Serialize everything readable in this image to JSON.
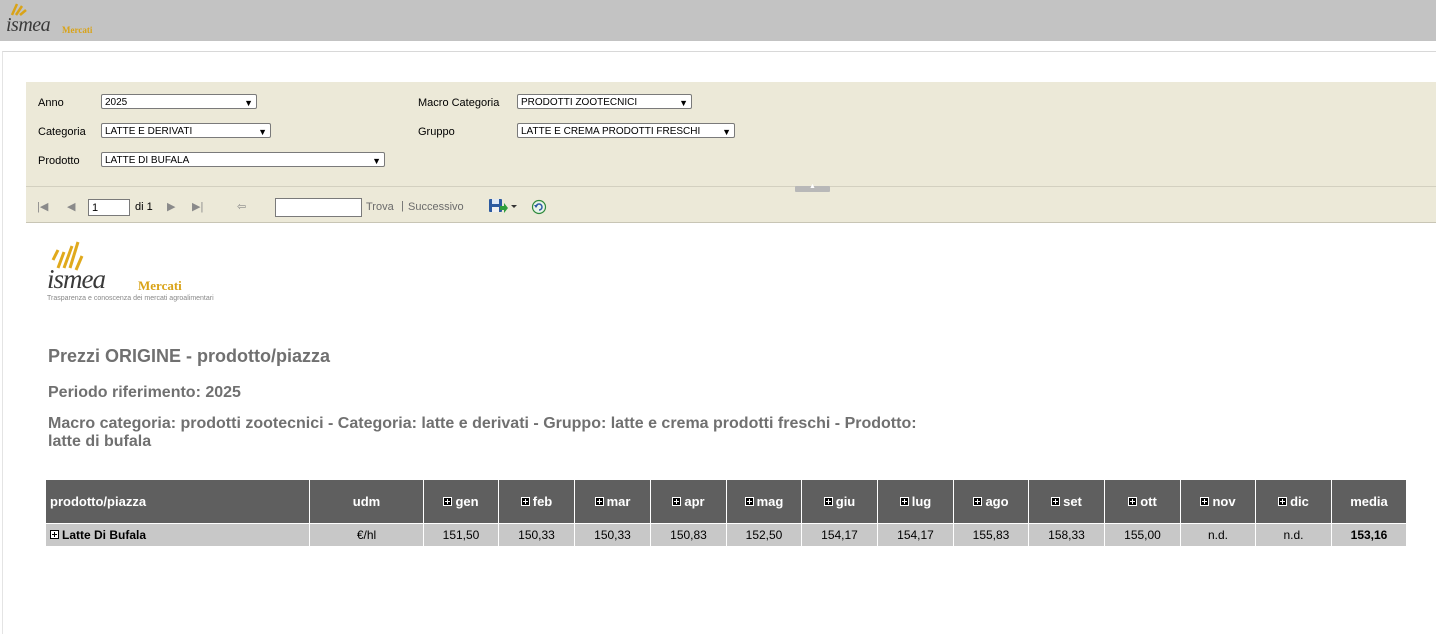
{
  "header": {
    "logo_text": "ismea",
    "logo_suffix": "Mercati"
  },
  "params": {
    "anno": {
      "label": "Anno",
      "value": "2025"
    },
    "macro": {
      "label": "Macro Categoria",
      "value": "PRODOTTI ZOOTECNICI"
    },
    "categoria": {
      "label": "Categoria",
      "value": "LATTE E DERIVATI"
    },
    "gruppo": {
      "label": "Gruppo",
      "value": "LATTE E CREMA PRODOTTI FRESCHI"
    },
    "prodotto": {
      "label": "Prodotto",
      "value": "LATTE DI BUFALA"
    }
  },
  "toolbar": {
    "page": "1",
    "of_label": "di 1",
    "find_label": "Trova",
    "sep": "|",
    "next_label": "Successivo",
    "find_placeholder": ""
  },
  "report": {
    "logo_text": "ismea",
    "logo_suffix": "Mercati",
    "logo_tagline": "Trasparenza e conoscenza dei mercati agroalimentari",
    "title": "Prezzi ORIGINE - prodotto/piazza",
    "periodo": "Periodo riferimento: 2025",
    "description": "Macro categoria: prodotti zootecnici - Categoria: latte e derivati - Gruppo: latte e crema prodotti freschi - Prodotto: latte di bufala"
  },
  "table": {
    "headers": [
      "prodotto/piazza",
      "udm",
      "gen",
      "feb",
      "mar",
      "apr",
      "mag",
      "giu",
      "lug",
      "ago",
      "set",
      "ott",
      "nov",
      "dic",
      "media"
    ],
    "row": {
      "name": "Latte Di Bufala",
      "udm": "€/hl",
      "values": [
        "151,50",
        "150,33",
        "150,33",
        "150,83",
        "152,50",
        "154,17",
        "154,17",
        "155,83",
        "158,33",
        "155,00",
        "n.d.",
        "n.d."
      ],
      "media": "153,16"
    }
  }
}
